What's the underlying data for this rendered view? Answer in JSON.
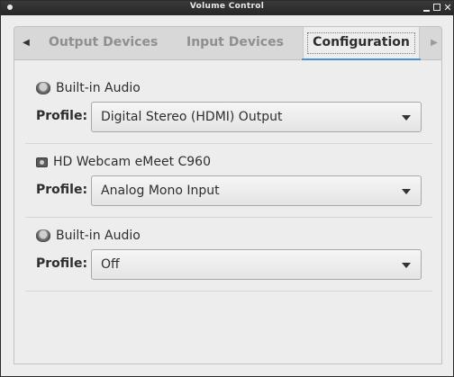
{
  "window": {
    "title": "Volume Control",
    "controls": [
      "menu-icon",
      "minimize-icon",
      "maximize-icon",
      "close-icon"
    ]
  },
  "tabs": [
    {
      "label": "Output Devices",
      "active": false
    },
    {
      "label": "Input Devices",
      "active": false
    },
    {
      "label": "Configuration",
      "active": true
    }
  ],
  "accent_color": "#4a90d9",
  "devices": [
    {
      "name": "Built-in Audio",
      "icon": "speaker-icon",
      "profile_label": "Profile:",
      "profile": "Digital Stereo (HDMI) Output"
    },
    {
      "name": "HD Webcam eMeet C960",
      "icon": "webcam-icon",
      "profile_label": "Profile:",
      "profile": "Analog Mono Input"
    },
    {
      "name": "Built-in Audio",
      "icon": "speaker-icon",
      "profile_label": "Profile:",
      "profile": "Off"
    }
  ]
}
